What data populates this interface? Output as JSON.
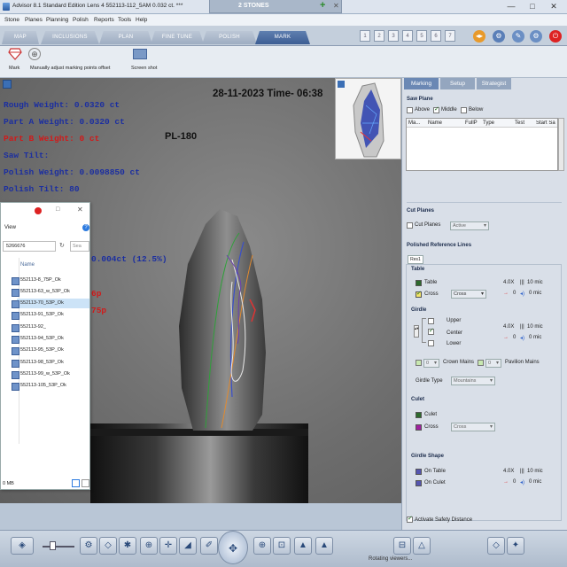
{
  "window": {
    "title": "Advisor 8.1 Standard Edition Lens 4  552113-112_5AM  0.032 ct. ***",
    "stone_tab": "2 STONES",
    "controls": [
      "—",
      "□",
      "✕"
    ]
  },
  "menu": [
    "Stone",
    "Planes",
    "Planning",
    "Polish",
    "Reports",
    "Tools",
    "Help"
  ],
  "process_tabs": [
    "MAP",
    "INCLUSIONS",
    "PLAN",
    "FINE TUNE",
    "POLISH",
    "MARK"
  ],
  "active_tab": "MARK",
  "number_boxes": [
    "1",
    "2",
    "3",
    "4",
    "5",
    "6",
    "7"
  ],
  "toolbar": {
    "mark_label": "Mark",
    "adjust_label": "Manually adjust marking points offset",
    "screenshot_label": "Screen shot"
  },
  "canvas": {
    "datetime": "28-11-2023 Time- 06:38",
    "code": "PL-180",
    "rough_weight": "Rough Weight: 0.0320 ct",
    "part_a_weight": "Part A Weight: 0.0320 ct",
    "part_b_weight": "Part B Weight: 0 ct",
    "saw_tilt": "Saw Tilt:",
    "polish_weight": "Polish Weight: 0.0098850 ct",
    "polish_tilt": "Polish Tilt: 80",
    "partial_weight": "0.004ct (12.5%)",
    "partial_6p": "6p",
    "partial_75p": "75p"
  },
  "explorer": {
    "path": "5266676",
    "view_label": "View",
    "search_label": "Sea",
    "column_name": "Name",
    "files": [
      "552113-8_75P_Ok",
      "552113-63_w_53P_Ok",
      "552113-70_53P_Ok",
      "552113-91_53P_Ok",
      "552113-92_",
      "552113-94_53P_Ok",
      "552113-95_53P_Ok",
      "552113-98_53P_Ok",
      "552113-99_w_53P_Ok",
      "552113-105_53P_Ok"
    ],
    "size": "0 MB"
  },
  "panel": {
    "tabs": [
      "Marking",
      "Setup",
      "Strategist"
    ],
    "saw_plane": "Saw Plane",
    "above": "Above",
    "middle": "Middle",
    "below": "Below",
    "columns": [
      "Ma...",
      "Name",
      "FullP",
      "Type",
      "Test",
      "Start Sa"
    ],
    "cut_planes": "Cut Planes",
    "cut_planes_check": "Cut Planes",
    "active": "Active",
    "polished_ref": "Polished Reference Lines",
    "res_tab": "Res1",
    "table": "Table",
    "table_item": "Table",
    "cross": "Cross",
    "cross_select": "Cross",
    "zoom_a": "4.0X",
    "mic_a": "10 mic",
    "offset_a": "0",
    "mic_a2": "0 mic",
    "girdle": "Girdle",
    "upper": "Upper",
    "center": "Center",
    "lower": "Lower",
    "zoom_b": "4.0X",
    "mic_b": "10 mic",
    "offset_b": "0",
    "mic_b2": "0 mic",
    "crown_mains": "Crown Mains",
    "pavilion_mains": "Pavilion Mains",
    "crown_val": "0",
    "pav_val": "0",
    "girdle_type": "Girdle Type",
    "girdle_type_val": "Mountains",
    "culet": "Culet",
    "culet_item": "Culet",
    "culet_cross": "Cross",
    "culet_cross_val": "Cross",
    "girdle_shape": "Girdle Shape",
    "on_table": "On Table",
    "on_culet": "On Culet",
    "zoom_c": "4.0X",
    "mic_c": "10 mic",
    "offset_c": "0",
    "mic_c2": "0 mic",
    "safety": "Activate Safety Distance"
  },
  "status": "Rotating viewers...",
  "colors": {
    "rough": "#1c2fa0",
    "part_b": "#d11a1a",
    "polish": "#1c2fa0",
    "tab_active": "#3c5d93",
    "panel_tab_active": "#6b88b4"
  }
}
